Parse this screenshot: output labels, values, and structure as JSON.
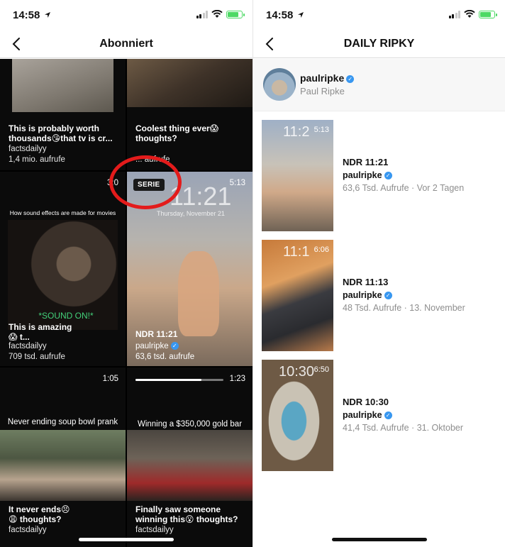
{
  "left": {
    "time": "14:58",
    "nav_title": "Abonniert",
    "cells": [
      {
        "caption": "This is probably worth thousands😘that tv is cr...",
        "account": "factsdailyy",
        "views": "1,4 mio. aufrufe"
      },
      {
        "caption": "Coolest thing ever😱 thoughts?",
        "account": "",
        "views": "... aufrufe"
      },
      {
        "duration": "3:0",
        "top_title": "How sound effects are made for movies",
        "overlay": "*SOUND ON!*",
        "caption": "This is amazing😱 t...",
        "account": "factsdailyy",
        "views": "709 tsd. aufrufe"
      },
      {
        "badge": "SERIE",
        "clock": "11:21",
        "date": "Thursday, November 21",
        "duration": "5:13",
        "caption": "NDR 11:21",
        "account": "paulripke",
        "views": "63,6 tsd. aufrufe"
      },
      {
        "duration": "1:05",
        "title": "Never ending soup bowl prank",
        "caption": "It never ends😣 😩 thoughts?",
        "account": "factsdailyy"
      },
      {
        "duration": "1:23",
        "progress": 0.75,
        "title": "Winning a $350,000 gold bar",
        "caption": "Finally saw someone winning this😮 thoughts?",
        "account": "factsdailyy"
      }
    ]
  },
  "right": {
    "time": "14:58",
    "nav_title": "DAILY RIPKY",
    "profile": {
      "username": "paulripke",
      "full_name": "Paul Ripke"
    },
    "items": [
      {
        "clock": "11:2",
        "duration": "5:13",
        "title": "NDR 11:21",
        "user": "paulripke",
        "stats": "63,6 Tsd. Aufrufe · Vor 2 Tagen"
      },
      {
        "clock": "11:1",
        "duration": "6:06",
        "title": "NDR 11:13",
        "user": "paulripke",
        "stats": "48 Tsd. Aufrufe · 13. November"
      },
      {
        "clock": "10:30",
        "duration": "6:50",
        "title": "NDR 10:30",
        "user": "paulripke",
        "stats": "41,4 Tsd. Aufrufe · 31. Oktober"
      }
    ]
  },
  "icons": [
    "back-chevron-icon",
    "location-arrow-icon",
    "signal-icon",
    "wifi-icon",
    "battery-icon",
    "verified-badge-icon"
  ],
  "colors": {
    "highlight_circle": "#e31b1b",
    "verified": "#3897f0",
    "battery": "#4cd964"
  }
}
